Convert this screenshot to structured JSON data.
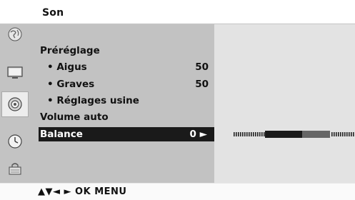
{
  "header": {
    "title": "Son"
  },
  "menu": {
    "items": [
      {
        "label": "Préréglage",
        "value": ""
      },
      {
        "label": "• Aigus",
        "value": "50"
      },
      {
        "label": "• Graves",
        "value": "50"
      },
      {
        "label": "• Réglages usine",
        "value": ""
      },
      {
        "label": "Volume auto",
        "value": ""
      },
      {
        "label": "Balance",
        "value": "0 ►"
      }
    ],
    "selected": "Balance"
  },
  "slider": {
    "label": "Balance",
    "value": 0,
    "range": [
      -50,
      50
    ]
  },
  "sidebar": {
    "icons": [
      "globe-icon",
      "tv-picture-icon",
      "speaker-sound-icon",
      "clock-icon",
      "lock-icon"
    ],
    "active": "speaker-sound-icon"
  },
  "footer": {
    "hint": "▲▼◄ ► OK MENU"
  },
  "colors": {
    "menu_bg": "#c2c2c2",
    "selection_bg": "#1a1a1a",
    "slider_active": "#666666"
  }
}
